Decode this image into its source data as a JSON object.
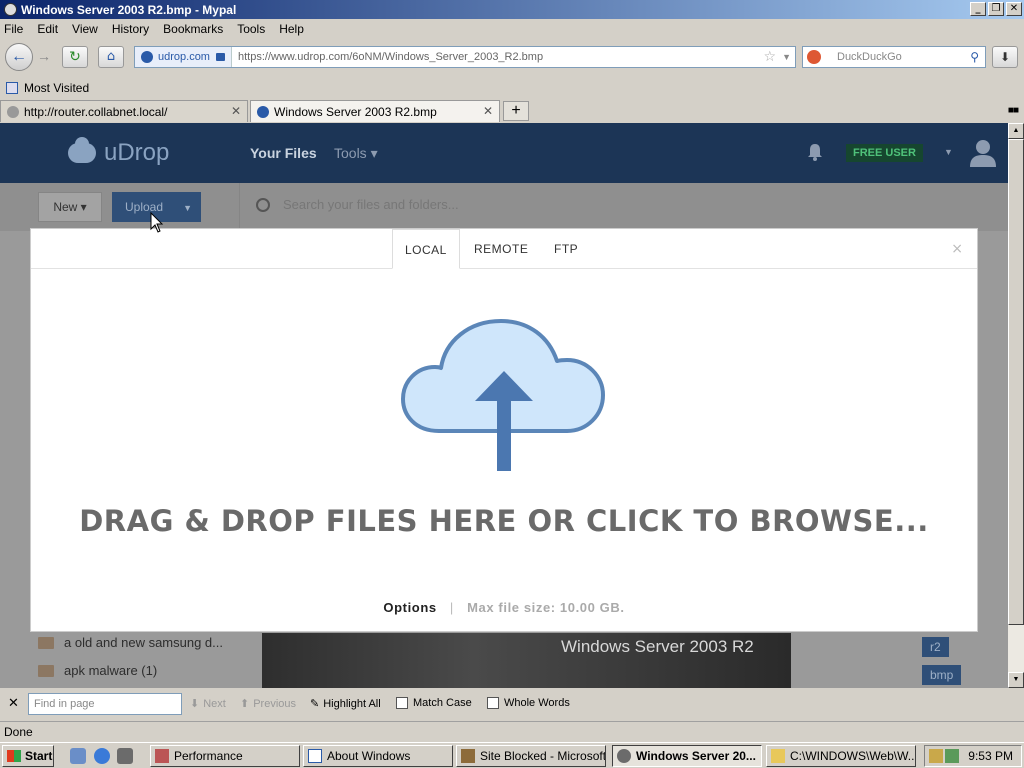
{
  "window": {
    "title": "Windows Server 2003 R2.bmp - Mypal",
    "btn_min": "_",
    "btn_max": "❐",
    "btn_close": "✕"
  },
  "menu": [
    "File",
    "Edit",
    "View",
    "History",
    "Bookmarks",
    "Tools",
    "Help"
  ],
  "nav": {
    "identity": "udrop.com",
    "url": "https://www.udrop.com/6oNM/Windows_Server_2003_R2.bmp",
    "search_placeholder": "DuckDuckGo"
  },
  "bookmarks": {
    "most_visited": "Most Visited"
  },
  "tabs": [
    {
      "label": "http://router.collabnet.local/",
      "active": false
    },
    {
      "label": "Windows Server 2003 R2.bmp",
      "active": true
    }
  ],
  "app": {
    "logo": "uDrop",
    "nav_files": "Your Files",
    "nav_tools": "Tools ▾",
    "badge": "FREE USER",
    "btn_new": "New ▾",
    "btn_upload": "Upload",
    "search_placeholder": "Search your files and folders..."
  },
  "sidebar": {
    "folders": [
      "a old and new samsung d...",
      "apk malware (1)"
    ]
  },
  "preview": {
    "text": "Windows Server 2003 R2"
  },
  "tags": [
    "r2",
    "bmp"
  ],
  "upload_modal": {
    "tabs": [
      "LOCAL",
      "REMOTE",
      "FTP"
    ],
    "active_tab": "LOCAL",
    "close": "×",
    "dropzone_text": "DRAG & DROP FILES HERE OR CLICK TO BROWSE...",
    "options": "Options",
    "separator": "|",
    "max_size": "Max file size: 10.00 GB."
  },
  "findbar": {
    "placeholder": "Find in page",
    "next": "Next",
    "previous": "Previous",
    "highlight_all": "Highlight All",
    "match_case": "Match Case",
    "whole_words": "Whole Words"
  },
  "status": "Done",
  "taskbar": {
    "start": "Start",
    "tasks": [
      {
        "label": "Performance",
        "active": false
      },
      {
        "label": "About Windows",
        "active": false
      },
      {
        "label": "Site Blocked - Microsoft...",
        "active": false
      },
      {
        "label": "Windows Server 20...",
        "active": true
      },
      {
        "label": "C:\\WINDOWS\\Web\\W...",
        "active": false
      }
    ],
    "clock": "9:53 PM"
  },
  "colors": {
    "header": "#1c3556",
    "accent": "#2f4f78",
    "badge_green": "#4fc27a",
    "cloud_fill": "#cfe6fb",
    "cloud_stroke": "#5b86b8"
  }
}
